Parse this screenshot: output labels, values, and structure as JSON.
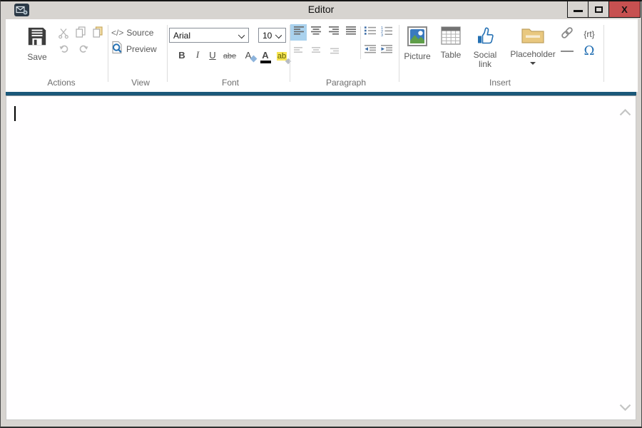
{
  "window": {
    "title": "Editor"
  },
  "controls": {
    "minimize": "minimize",
    "maximize": "maximize",
    "close_glyph": "X"
  },
  "ribbon": {
    "actions": {
      "label": "Actions",
      "save": "Save"
    },
    "view": {
      "label": "View",
      "source_glyph": "</>",
      "source": "Source",
      "preview": "Preview"
    },
    "font": {
      "label": "Font",
      "family_value": "Arial",
      "size_value": "10",
      "bold_glyph": "B",
      "italic_glyph": "I",
      "underline_glyph": "U",
      "strikethrough_glyph": "abe",
      "remove_format_glyph": "A",
      "text_color_glyph": "A",
      "highlight_glyph": "ab"
    },
    "paragraph": {
      "label": "Paragraph"
    },
    "insert": {
      "label": "Insert",
      "picture": "Picture",
      "table": "Table",
      "social_link": "Social link",
      "placeholder": "Placeholder",
      "rich_text_glyph": "{rt}",
      "omega_glyph": "Ω"
    }
  },
  "editor": {
    "content": ""
  },
  "colors": {
    "accent_line": "#1a5879",
    "close_button": "#c75050",
    "selected_button_bg": "#aad2ee",
    "highlight_yellow": "#f7e551",
    "icon_blue": "#2470b3",
    "folder_tan": "#e9c87f"
  }
}
